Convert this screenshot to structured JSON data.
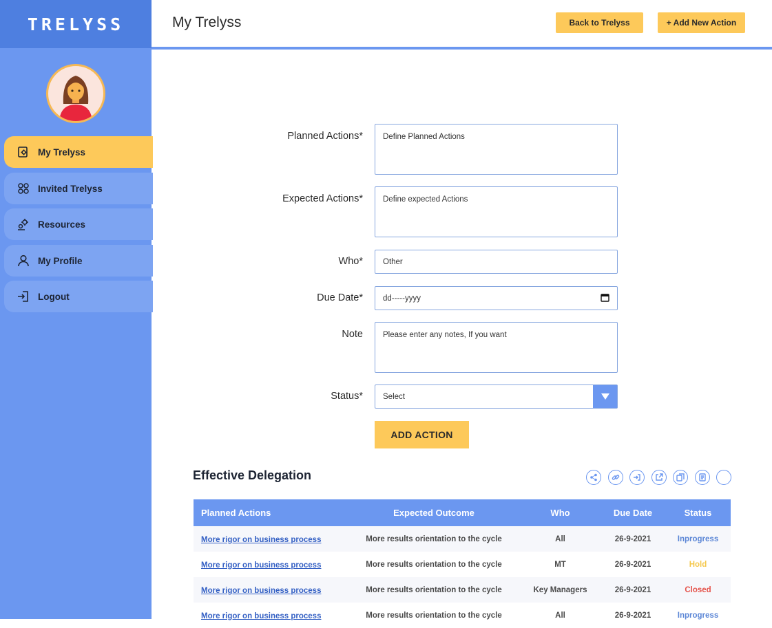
{
  "app": {
    "logo": "TRELYSS"
  },
  "sidebar": {
    "items": [
      {
        "label": "My Trelyss",
        "icon": "gear-document-icon",
        "active": true
      },
      {
        "label": "Invited Trelyss",
        "icon": "group-icon",
        "active": false
      },
      {
        "label": "Resources",
        "icon": "gears-icon",
        "active": false
      },
      {
        "label": "My Profile",
        "icon": "user-icon",
        "active": false
      },
      {
        "label": "Logout",
        "icon": "logout-icon",
        "active": false
      }
    ]
  },
  "header": {
    "title": "My Trelyss",
    "back_label": "Back to Trelyss",
    "add_label": "+ Add New Action"
  },
  "form": {
    "planned": {
      "label": "Planned Actions*",
      "placeholder": "Define Planned Actions"
    },
    "expected": {
      "label": "Expected Actions*",
      "placeholder": "Define expected Actions"
    },
    "who": {
      "label": "Who*",
      "value": "Other"
    },
    "due": {
      "label": "Due Date*",
      "value": "dd-----yyyy"
    },
    "note": {
      "label": "Note",
      "placeholder": "Please enter any notes, If you want"
    },
    "status": {
      "label": "Status*",
      "value": "Select"
    },
    "submit_label": "ADD ACTION"
  },
  "section": {
    "title": "Effective Delegation",
    "tools": [
      "share-icon",
      "link-icon",
      "login-icon",
      "export-icon",
      "copy-icon",
      "report-icon",
      "blank-circle-icon"
    ]
  },
  "table": {
    "headers": [
      "Planned Actions",
      "Expected Outcome",
      "Who",
      "Due Date",
      "Status"
    ],
    "rows": [
      {
        "planned": "More rigor on business process",
        "outcome": "More results orientation to the cycle",
        "who": "All",
        "due": "26-9-2021",
        "status": "Inprogress"
      },
      {
        "planned": "More rigor on business process",
        "outcome": "More results orientation to the cycle",
        "who": "MT",
        "due": "26-9-2021",
        "status": "Hold"
      },
      {
        "planned": "More rigor on business process",
        "outcome": "More results orientation to the cycle",
        "who": "Key Managers",
        "due": "26-9-2021",
        "status": "Closed"
      },
      {
        "planned": "More rigor on business process",
        "outcome": "More results orientation to the cycle",
        "who": "All",
        "due": "26-9-2021",
        "status": "Inprogress"
      }
    ]
  },
  "colors": {
    "accent": "#6b97f0",
    "highlight": "#fdc95a",
    "status_inprogress": "#5b86d6",
    "status_hold": "#f5c84b",
    "status_closed": "#e5534b"
  }
}
